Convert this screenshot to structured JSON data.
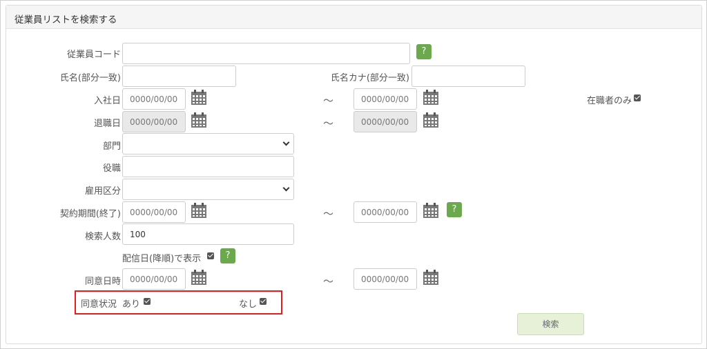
{
  "panel": {
    "title": "従業員リストを検索する"
  },
  "fields": {
    "employee_code_label": "従業員コード",
    "name_label": "氏名(部分一致)",
    "name_kana_label": "氏名カナ(部分一致)",
    "join_date_label": "入社日",
    "retire_date_label": "退職日",
    "department_label": "部門",
    "position_label": "役職",
    "employment_type_label": "雇用区分",
    "contract_end_label": "契約期間(終了)",
    "search_count_label": "検索人数",
    "search_count_value": "100",
    "delivery_sort_label": "配信日(降順)で表示",
    "consent_date_label": "同意日時",
    "consent_status_label": "同意状況",
    "consent_yes_label": "あり",
    "consent_no_label": "なし",
    "in_office_only_label": "在職者のみ"
  },
  "date_placeholder": "0000/00/00",
  "range_sep": "～",
  "help_label": "?",
  "search_button_label": "検索",
  "colors": {
    "help": "#6ca84e",
    "highlight": "#e11d1d",
    "search_button": "#e6f1d8"
  }
}
